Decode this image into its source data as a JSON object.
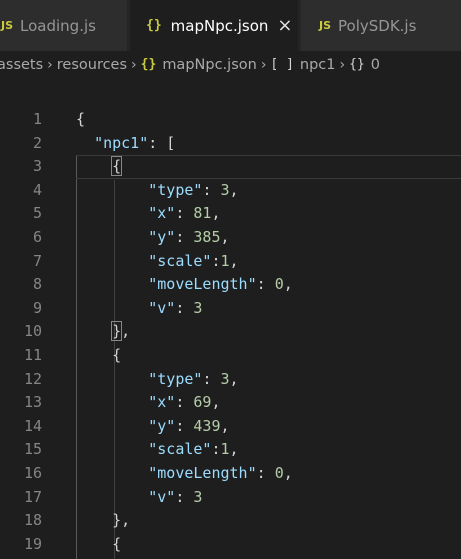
{
  "tabs": [
    {
      "label": "Loading.js",
      "icon": "js-icon",
      "icon_text": "JS",
      "active": false
    },
    {
      "label": "mapNpc.json",
      "icon": "json-braces-icon",
      "icon_text": "{}",
      "active": true,
      "close": "×"
    },
    {
      "label": "PolySDK.js",
      "icon": "js-icon",
      "icon_text": "JS",
      "active": false
    }
  ],
  "breadcrumb": {
    "items": [
      "assets",
      "resources",
      "mapNpc.json",
      "npc1",
      "0"
    ],
    "separator": "›",
    "file_icon_text": "{}",
    "array_icon_text": "[ ]",
    "object_icon_text": "{}"
  },
  "editor": {
    "lines": [
      {
        "num": "1",
        "code": "{"
      },
      {
        "num": "2",
        "code": "  \"npc1\": ["
      },
      {
        "num": "3",
        "code": "    {"
      },
      {
        "num": "4",
        "code": "        \"type\": 3,"
      },
      {
        "num": "5",
        "code": "        \"x\": 81,"
      },
      {
        "num": "6",
        "code": "        \"y\": 385,"
      },
      {
        "num": "7",
        "code": "        \"scale\":1,"
      },
      {
        "num": "8",
        "code": "        \"moveLength\": 0,"
      },
      {
        "num": "9",
        "code": "        \"v\": 3"
      },
      {
        "num": "10",
        "code": "    },"
      },
      {
        "num": "11",
        "code": "    {"
      },
      {
        "num": "12",
        "code": "        \"type\": 3,"
      },
      {
        "num": "13",
        "code": "        \"x\": 69,"
      },
      {
        "num": "14",
        "code": "        \"y\": 439,"
      },
      {
        "num": "15",
        "code": "        \"scale\":1,"
      },
      {
        "num": "16",
        "code": "        \"moveLength\": 0,"
      },
      {
        "num": "17",
        "code": "        \"v\": 3"
      },
      {
        "num": "18",
        "code": "    },"
      },
      {
        "num": "19",
        "code": "    {"
      }
    ]
  },
  "colors": {
    "background": "#1e1e1e",
    "tabbar": "#252526",
    "inactive_tab": "#2d2d2d",
    "js_icon": "#cbcb41",
    "key": "#9cdcfe",
    "number": "#b5cea8",
    "line_number": "#858585"
  }
}
